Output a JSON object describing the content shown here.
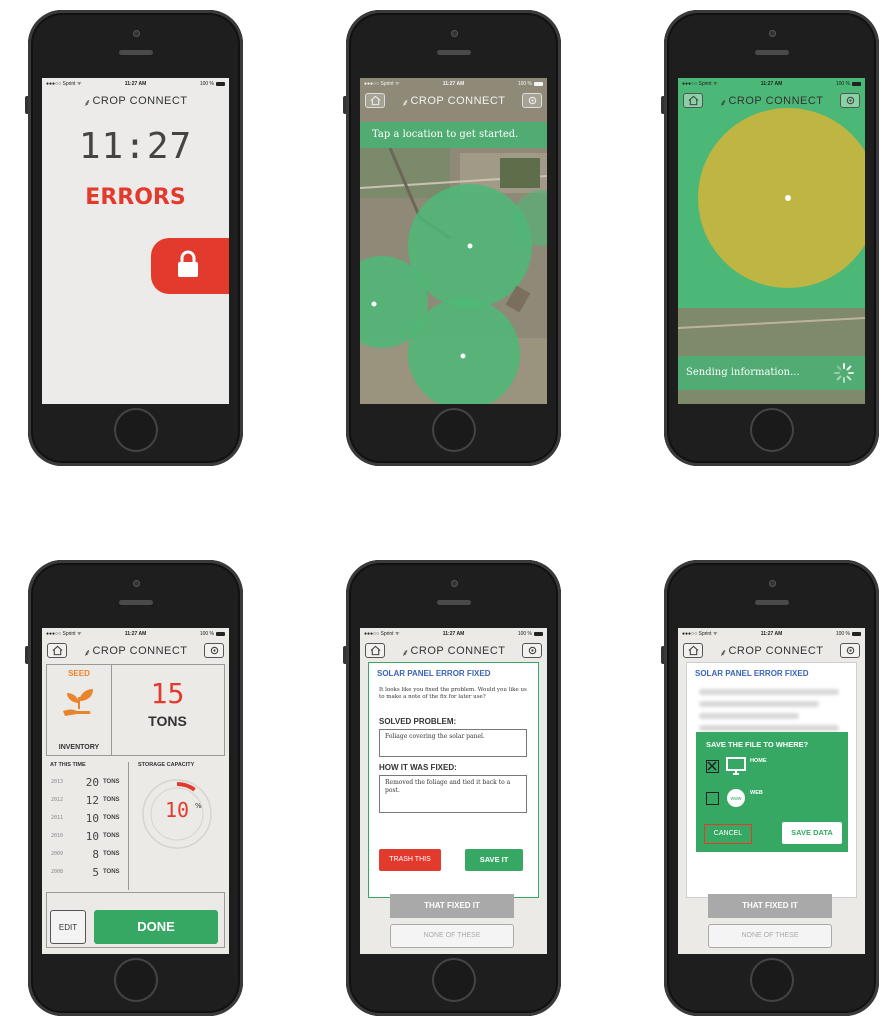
{
  "status": {
    "carrier": "●●●○○ Sprint ᯤ",
    "time": "11:27 AM",
    "battery": "100 %"
  },
  "brand": {
    "logo_text": "CROP CONNECT"
  },
  "lock_screen": {
    "clock": "11:27",
    "alert": "ERRORS"
  },
  "map_screen": {
    "banner": "Tap a location to get started."
  },
  "sending_screen": {
    "banner": "Sending information..."
  },
  "inventory": {
    "seed_label": "SEED",
    "inventory_label": "INVENTORY",
    "amount": "15",
    "unit": "TONS",
    "col_history": "AT THIS TIME",
    "col_storage": "STORAGE CAPACITY",
    "history": [
      {
        "year": "2013",
        "amount": "20",
        "unit": "TONS"
      },
      {
        "year": "2012",
        "amount": "12",
        "unit": "TONS"
      },
      {
        "year": "2011",
        "amount": "10",
        "unit": "TONS"
      },
      {
        "year": "2010",
        "amount": "10",
        "unit": "TONS"
      },
      {
        "year": "2009",
        "amount": "8",
        "unit": "TONS"
      },
      {
        "year": "2008",
        "amount": "5",
        "unit": "TONS"
      }
    ],
    "storage_value": "10",
    "storage_unit": "%",
    "storage_fraction": 0.1,
    "edit_label": "EDIT",
    "done_label": "DONE"
  },
  "fix_report": {
    "title": "SOLAR PANEL ERROR FIXED",
    "intro": "It looks like you fixed the problem. Would you like us to make a note of the fix for later use?",
    "solved_heading": "SOLVED PROBLEM:",
    "solved_text": "Foliage covering the solar panel.",
    "how_heading": "HOW IT WAS FIXED:",
    "how_text": "Removed the foliage and tied it back to a post.",
    "trash_label": "TRASH THIS",
    "save_label": "SAVE IT",
    "fixed_label": "THAT FIXED IT",
    "none_label": "NONE OF THESE"
  },
  "save_dialog": {
    "title": "SAVE THE FILE TO WHERE?",
    "home_label": "HOME",
    "web_label": "WEB",
    "cancel_label": "CANCEL",
    "savedata_label": "SAVE DATA"
  },
  "colors": {
    "accent_green": "#36a863",
    "alert_red": "#e23b2e",
    "title_blue": "#3a64b8",
    "seed_orange": "#e9842d"
  }
}
